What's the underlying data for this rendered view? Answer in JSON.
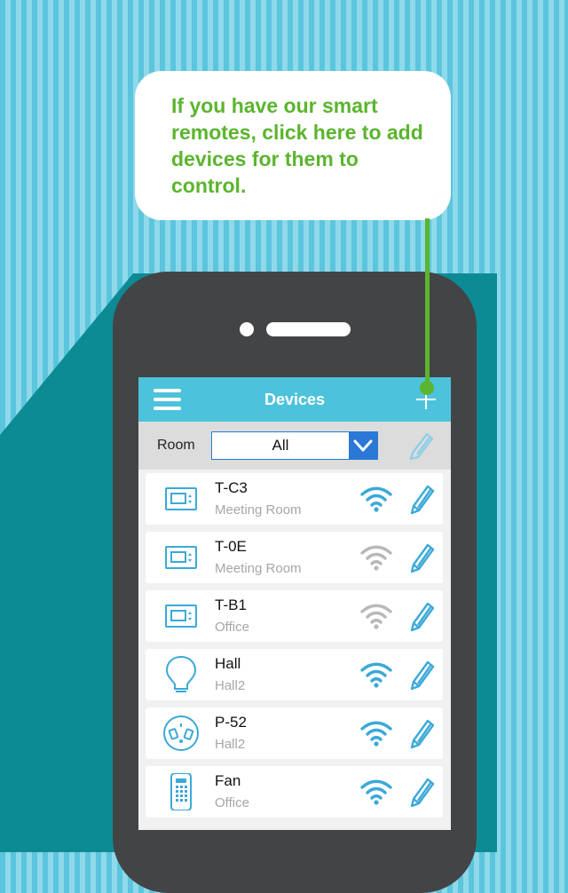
{
  "header": {
    "title": "Devices"
  },
  "filter": {
    "room_label": "Room",
    "selected": "All"
  },
  "devices": [
    {
      "name": "T-C3",
      "room": "Meeting Room",
      "icon": "thermostat-icon",
      "wifi": "connected"
    },
    {
      "name": "T-0E",
      "room": "Meeting Room",
      "icon": "thermostat-icon",
      "wifi": "disconnected"
    },
    {
      "name": "T-B1",
      "room": "Office",
      "icon": "thermostat-icon",
      "wifi": "disconnected"
    },
    {
      "name": "Hall",
      "room": "Hall2",
      "icon": "lightbulb-icon",
      "wifi": "connected"
    },
    {
      "name": "P-52",
      "room": "Hall2",
      "icon": "plug-icon",
      "wifi": "connected"
    },
    {
      "name": "Fan",
      "room": "Office",
      "icon": "remote-control-icon",
      "wifi": "connected"
    }
  ],
  "callout": {
    "text": "If you have our smart remotes, click here to add devices for them to control."
  },
  "colors": {
    "header": "#4dc3db",
    "accent_blue": "#2b78d6",
    "wifi_on": "#3ba9d8",
    "wifi_off": "#b8b8b8",
    "callout_green": "#5bb52e"
  }
}
